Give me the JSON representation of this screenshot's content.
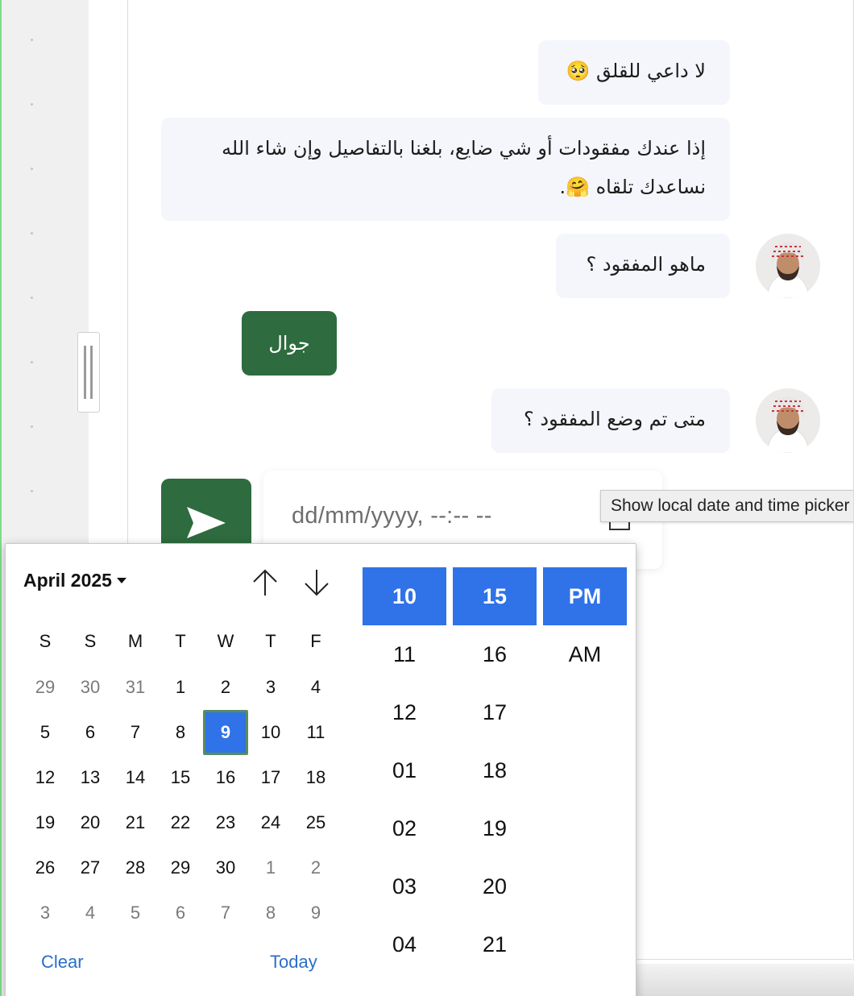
{
  "chat": {
    "messages": [
      {
        "text": "لا داعي للقلق 🥺"
      },
      {
        "line1": "إذا عندك مفقودات أو شي ضايع، بلغنا بالتفاصيل وإن شاء الله",
        "line2": "نساعدك تلقاه 🤗."
      },
      {
        "text": "ماهو المفقود ؟"
      },
      {
        "text": "متى تم وضع المفقود ؟"
      }
    ],
    "reply_button": "جوال"
  },
  "composer": {
    "date_value": "dd/mm/yyyy, --:-- --",
    "tooltip": "Show local date and time picker"
  },
  "picker": {
    "month_label": "April 2025",
    "weekdays": [
      "S",
      "S",
      "M",
      "T",
      "W",
      "T",
      "F"
    ],
    "weeks": [
      [
        "29",
        "30",
        "31",
        "1",
        "2",
        "3",
        "4"
      ],
      [
        "5",
        "6",
        "7",
        "8",
        "9",
        "10",
        "11"
      ],
      [
        "12",
        "13",
        "14",
        "15",
        "16",
        "17",
        "18"
      ],
      [
        "19",
        "20",
        "21",
        "22",
        "23",
        "24",
        "25"
      ],
      [
        "26",
        "27",
        "28",
        "29",
        "30",
        "1",
        "2"
      ],
      [
        "3",
        "4",
        "5",
        "6",
        "7",
        "8",
        "9"
      ]
    ],
    "selected_day": "9",
    "clear_label": "Clear",
    "today_label": "Today",
    "hours": [
      "10",
      "11",
      "12",
      "01",
      "02",
      "03",
      "04"
    ],
    "minutes": [
      "15",
      "16",
      "17",
      "18",
      "19",
      "20",
      "21"
    ],
    "ampm": [
      "PM",
      "AM"
    ]
  },
  "colors": {
    "accent_green": "#2e6b3e",
    "selection_blue": "#3072e8",
    "bubble_bg": "#f4f6fb",
    "link_blue": "#2a6fc9"
  },
  "icons": {
    "send": "send-icon",
    "avatar": "person-avatar",
    "up": "arrow-up-icon",
    "down": "arrow-down-icon"
  }
}
